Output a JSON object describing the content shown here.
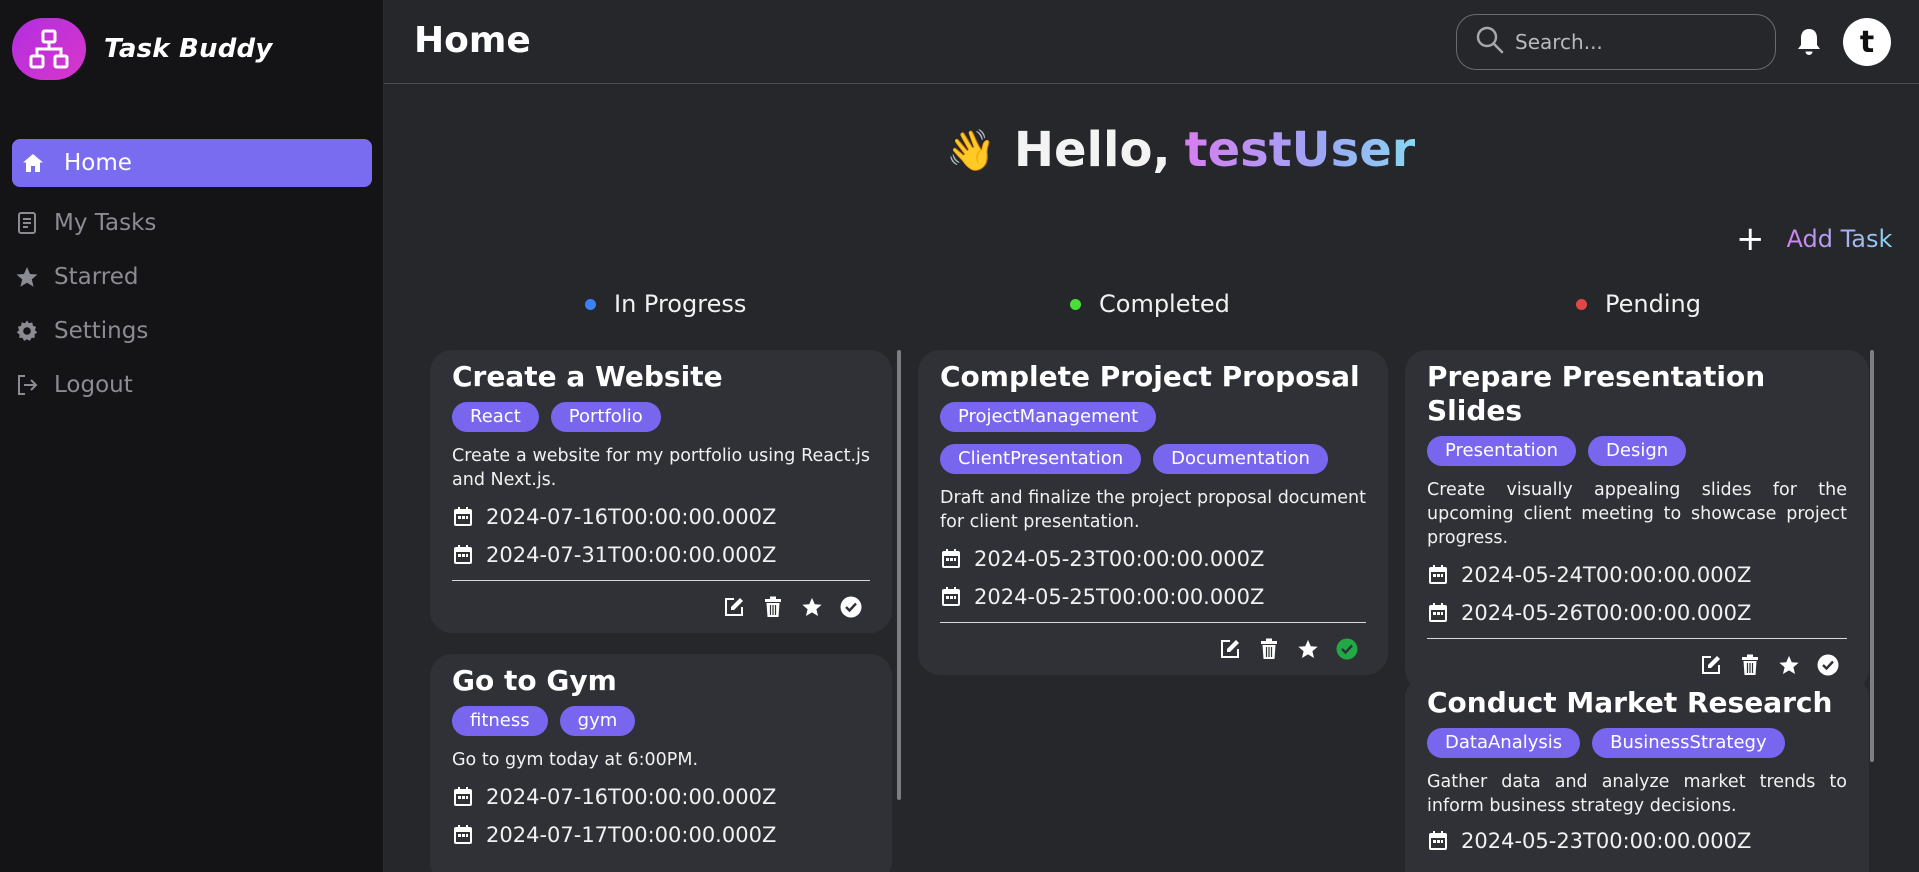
{
  "app": {
    "name": "Task Buddy"
  },
  "sidebar": {
    "items": [
      {
        "label": "Home",
        "icon": "home-icon"
      },
      {
        "label": "My Tasks",
        "icon": "clipboard-icon"
      },
      {
        "label": "Starred",
        "icon": "star-icon"
      },
      {
        "label": "Settings",
        "icon": "gear-icon"
      },
      {
        "label": "Logout",
        "icon": "logout-icon"
      }
    ]
  },
  "header": {
    "title": "Home",
    "search_placeholder": "Search...",
    "avatar_initial": "t"
  },
  "greeting": {
    "prefix": "Hello,",
    "username": "testUser",
    "emoji": "👋"
  },
  "add_task": {
    "icon": "+",
    "label": "Add Task"
  },
  "columns": [
    {
      "title": "In Progress",
      "dot_color": "#3b82f6",
      "cards": [
        {
          "title": "Create a Website",
          "tags": [
            "React",
            "Portfolio"
          ],
          "description": "Create a website for my portfolio using React.js and Next.js.",
          "start_date": "2024-07-16T00:00:00.000Z",
          "end_date": "2024-07-31T00:00:00.000Z",
          "completed": false
        },
        {
          "title": "Go to Gym",
          "tags": [
            "fitness",
            "gym"
          ],
          "description": "Go to gym today at 6:00PM.",
          "start_date": "2024-07-16T00:00:00.000Z",
          "end_date": "2024-07-17T00:00:00.000Z",
          "completed": false
        }
      ]
    },
    {
      "title": "Completed",
      "dot_color": "#4ade3b",
      "cards": [
        {
          "title": "Complete Project Proposal",
          "tags": [
            "ProjectManagement",
            "ClientPresentation",
            "Documentation"
          ],
          "description": "Draft and finalize the project proposal document for client presentation.",
          "start_date": "2024-05-23T00:00:00.000Z",
          "end_date": "2024-05-25T00:00:00.000Z",
          "completed": true
        }
      ]
    },
    {
      "title": "Pending",
      "dot_color": "#e04848",
      "cards": [
        {
          "title": "Prepare Presentation Slides",
          "tags": [
            "Presentation",
            "Design"
          ],
          "description": "Create visually appealing slides for the upcoming client meeting to showcase project progress.",
          "start_date": "2024-05-24T00:00:00.000Z",
          "end_date": "2024-05-26T00:00:00.000Z",
          "completed": false
        },
        {
          "title": "Conduct Market Research",
          "tags": [
            "DataAnalysis",
            "BusinessStrategy"
          ],
          "description": "Gather data and analyze market trends to inform business strategy decisions.",
          "start_date": "2024-05-23T00:00:00.000Z",
          "end_date": "",
          "completed": false
        }
      ]
    }
  ],
  "colors": {
    "accent": "#7a6cf0",
    "tag": "#7866ee",
    "completed_check": "#22a845"
  }
}
